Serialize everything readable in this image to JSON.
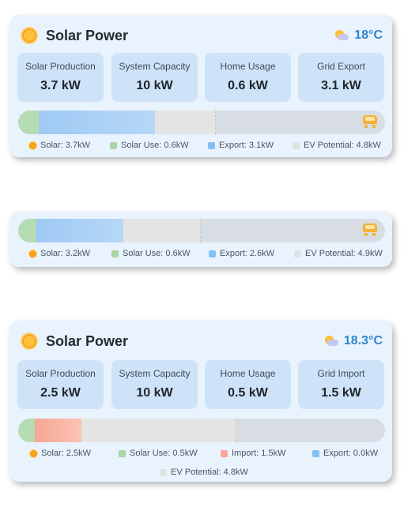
{
  "card1": {
    "title": "Solar Power",
    "temperature": "18°C",
    "stats": [
      {
        "label": "Solar Production",
        "value": "3.7 kW"
      },
      {
        "label": "System Capacity",
        "value": "10 kW"
      },
      {
        "label": "Home Usage",
        "value": "0.6 kW"
      },
      {
        "label": "Grid Export",
        "value": "3.1 kW"
      }
    ],
    "legend": {
      "solar": "Solar: 3.7kW",
      "use": "Solar Use: 0.6kW",
      "export": "Export: 3.1kW",
      "ev": "EV Potential: 4.8kW"
    }
  },
  "card2": {
    "legend": {
      "solar": "Solar: 3.2kW",
      "use": "Solar Use: 0.6kW",
      "export": "Export: 2.6kW",
      "ev": "EV Potential: 4.9kW"
    }
  },
  "card3": {
    "title": "Solar Power",
    "temperature": "18.3°C",
    "stats": [
      {
        "label": "Solar Production",
        "value": "2.5 kW"
      },
      {
        "label": "System Capacity",
        "value": "10 kW"
      },
      {
        "label": "Home Usage",
        "value": "0.5 kW"
      },
      {
        "label": "Grid Import",
        "value": "1.5 kW"
      }
    ],
    "legend": {
      "solar": "Solar: 2.5kW",
      "use": "Solar Use: 0.5kW",
      "import": "Import: 1.5kW",
      "export": "Export: 0.0kW",
      "ev": "EV Potential: 4.8kW"
    }
  },
  "icons": {
    "sun": "sun-icon",
    "weather": "partly-cloudy-icon",
    "ev": "ev-car-icon"
  },
  "colors": {
    "solar_use": "#a9d6a5",
    "export": "#86c0f2",
    "import": "#f8a796",
    "ev_potential": "#e2e2e2",
    "accent": "#2f86cd",
    "sun": "#f7a21a"
  }
}
